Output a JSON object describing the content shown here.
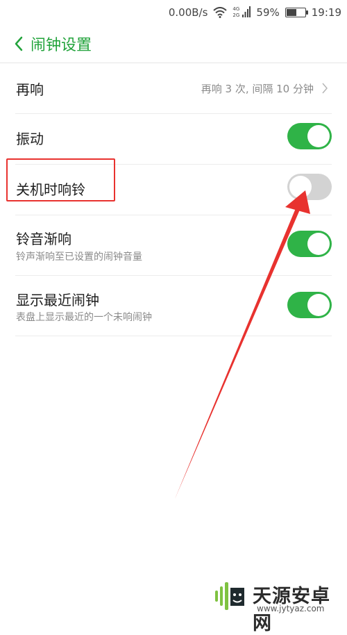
{
  "status_bar": {
    "net_speed": "0.00B/s",
    "net_type_top": "4G",
    "net_type_bottom": "2G",
    "battery_percent": "59%",
    "battery_level": 0.59,
    "time": "19:19"
  },
  "header": {
    "title": "闹钟设置"
  },
  "settings": {
    "snooze": {
      "label": "再响",
      "value": "再响 3 次, 间隔 10 分钟"
    },
    "vibrate": {
      "label": "振动",
      "on": true
    },
    "power_off_ring": {
      "label": "关机时响铃",
      "on": false
    },
    "fade_in": {
      "label": "铃音渐响",
      "sub": "铃声渐响至已设置的闹钟音量",
      "on": true
    },
    "show_next": {
      "label": "显示最近闹钟",
      "sub": "表盘上显示最近的一个未响闹钟",
      "on": true
    }
  },
  "annotation": {
    "color": "#e8322f"
  },
  "watermark": {
    "text": "天源安卓网",
    "url": "www.jytyaz.com"
  },
  "colors": {
    "accent": "#2fb347",
    "title_green": "#22a33b"
  }
}
